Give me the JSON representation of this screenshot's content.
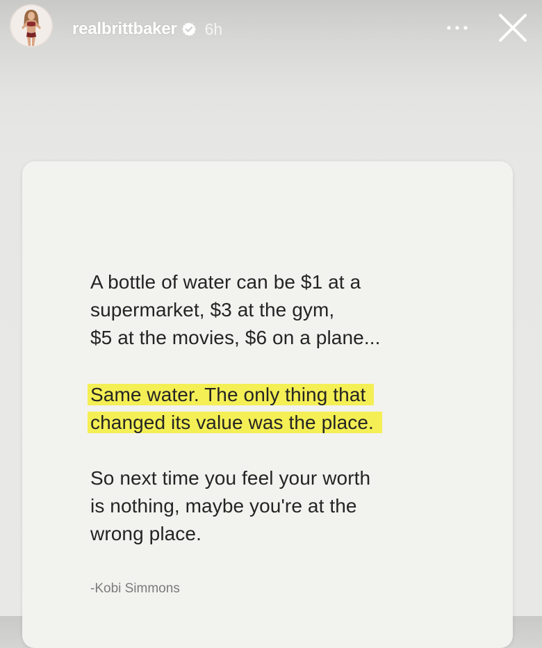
{
  "header": {
    "username": "realbrittbaker",
    "time": "6h",
    "avatar_icon": "profile-photo-avatar",
    "verified_icon": "verified-badge-icon",
    "more_icon": "more-dots-icon",
    "close_icon": "close-x-icon"
  },
  "post": {
    "paragraph1": [
      "A bottle of water can be $1 at a",
      "supermarket, $3 at the gym,",
      "$5 at the movies, $6 on a plane..."
    ],
    "highlight": [
      "Same water. The only thing that",
      "changed its value was the place."
    ],
    "paragraph3": [
      "So next time you feel your worth",
      "is nothing, maybe you're at the",
      "wrong place."
    ],
    "author": "-Kobi Simmons",
    "highlight_color": "#f4ef55",
    "text_color": "#242424",
    "author_color": "#7b7b7b"
  }
}
